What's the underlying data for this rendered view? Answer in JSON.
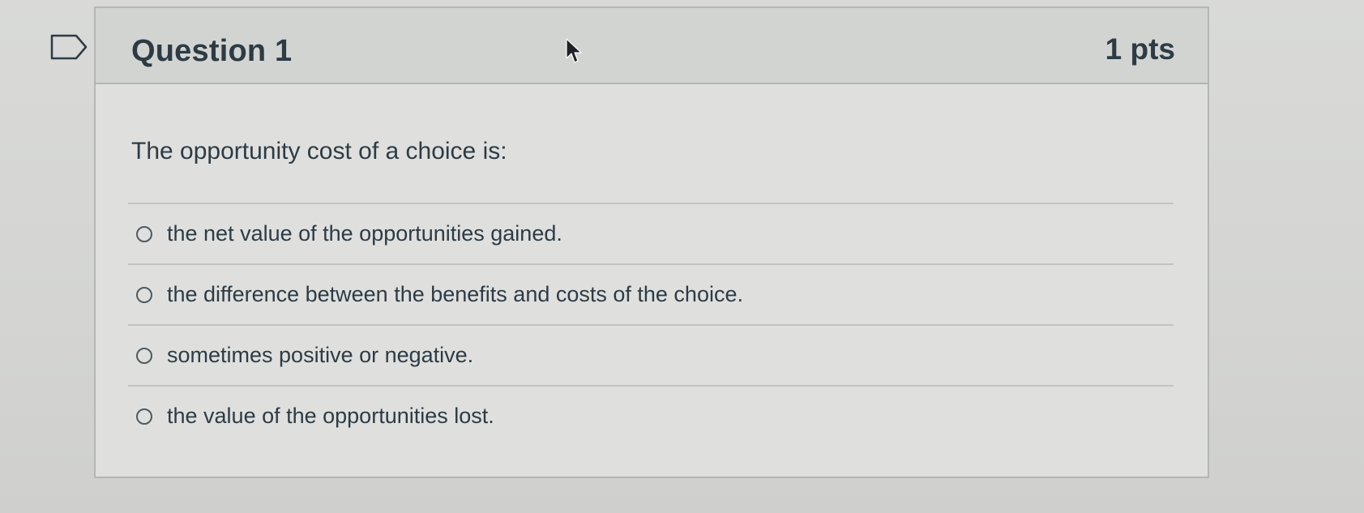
{
  "question": {
    "title": "Question 1",
    "points": "1 pts",
    "text": "The opportunity cost of a choice is:"
  },
  "answers": [
    {
      "label": "the net value of the opportunities gained.",
      "selected": false
    },
    {
      "label": "the difference between the benefits and costs of the choice.",
      "selected": false
    },
    {
      "label": "sometimes positive or negative.",
      "selected": false
    },
    {
      "label": "the value of the opportunities lost.",
      "selected": false
    }
  ],
  "icons": {
    "flag": "flag-icon",
    "cursor": "mouse-pointer-icon",
    "radio": "radio-button-icon"
  },
  "colors": {
    "text": "#2d3b45",
    "border": "#b3b6b5",
    "header_bg": "#d2d4d2",
    "card_bg": "#dfe0de"
  }
}
